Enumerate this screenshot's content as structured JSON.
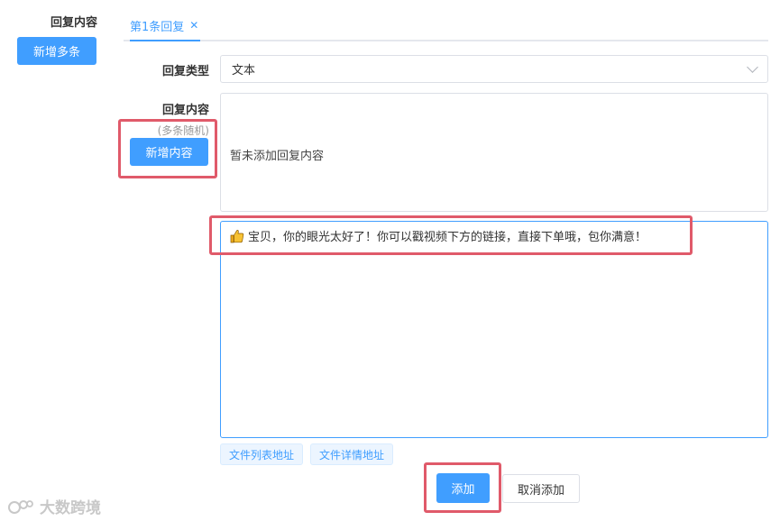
{
  "sidebar": {
    "label": "回复内容",
    "add_multi_button": "新增多条"
  },
  "tabs": [
    {
      "label": "第1条回复",
      "active": true,
      "close_icon": "close-icon"
    }
  ],
  "form": {
    "type_label": "回复类型",
    "type_value": "文本",
    "content_label": "回复内容",
    "content_hint": "(多条随机)",
    "add_content_button": "新增内容",
    "empty_text": "暂未添加回复内容",
    "message_text": "宝贝，你的眼光太好了！你可以戳视频下方的链接，直接下单哦，包你满意！",
    "message_icon": "thumbs-up-icon"
  },
  "tag_buttons": [
    "文件列表地址",
    "文件详情地址"
  ],
  "actions": {
    "submit": "添加",
    "cancel": "取消添加"
  },
  "watermark": "大数跨境",
  "colors": {
    "primary": "#409eff",
    "highlight": "#e05a6a"
  }
}
